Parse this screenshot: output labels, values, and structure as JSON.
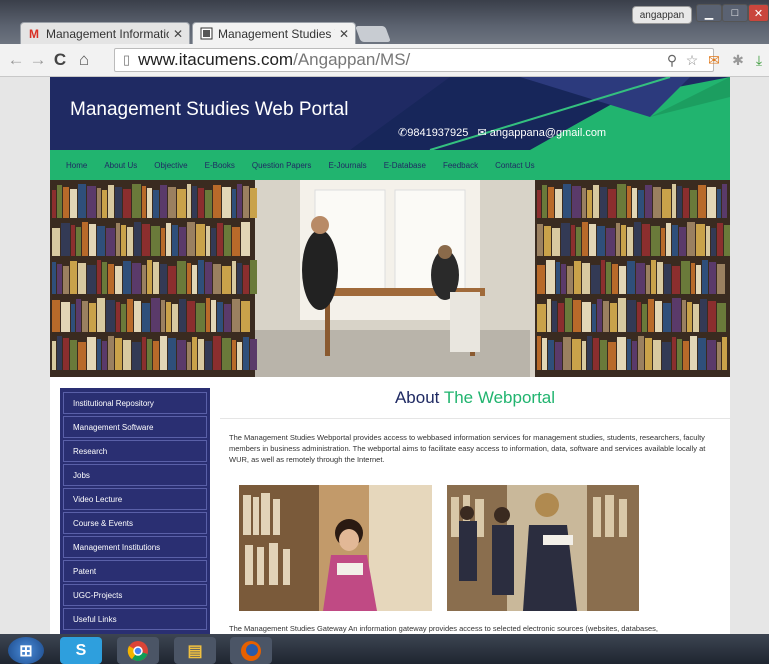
{
  "browser": {
    "tabs": [
      {
        "label": "Management Informatics",
        "icon": "gmail-icon"
      },
      {
        "label": "Management Studies Web",
        "icon": "page-icon"
      }
    ],
    "user": "angappan",
    "url_host": "www.itacumens.com",
    "url_path": "/Angappan/MS/"
  },
  "site": {
    "title": "Management Studies Web Portal",
    "phone": "9841937925",
    "email": "angappana@gmail.com",
    "colors": {
      "navy": "#1f2a63",
      "green": "#21b46f"
    },
    "menu": [
      "Home",
      "About Us",
      "Objective",
      "E-Books",
      "Question Papers",
      "E-Journals",
      "E-Database",
      "Feedback",
      "Contact Us"
    ],
    "sidebar": [
      "Institutional Repository",
      "Management Software",
      "Research",
      "Jobs",
      "Video Lecture",
      "Course & Events",
      "Management Institutions",
      "Patent",
      "UGC-Projects",
      "Useful Links"
    ],
    "about_prefix": "About",
    "about_highlight": "The Webportal",
    "paragraph1": "The Management Studies Webportal provides access to webbased information services for management studies, students, researchers, faculty members in business administration. The webportal aims to facilitate easy access to information, data, software and services available locally at WUR, as well as remotely through the Internet.",
    "paragraph2": "The Management Studies Gateway An information gateway provides access to selected electronic sources (websites, databases,"
  },
  "taskbar": [
    "start-button",
    "skype-icon",
    "chrome-icon",
    "explorer-icon",
    "firefox-icon"
  ]
}
